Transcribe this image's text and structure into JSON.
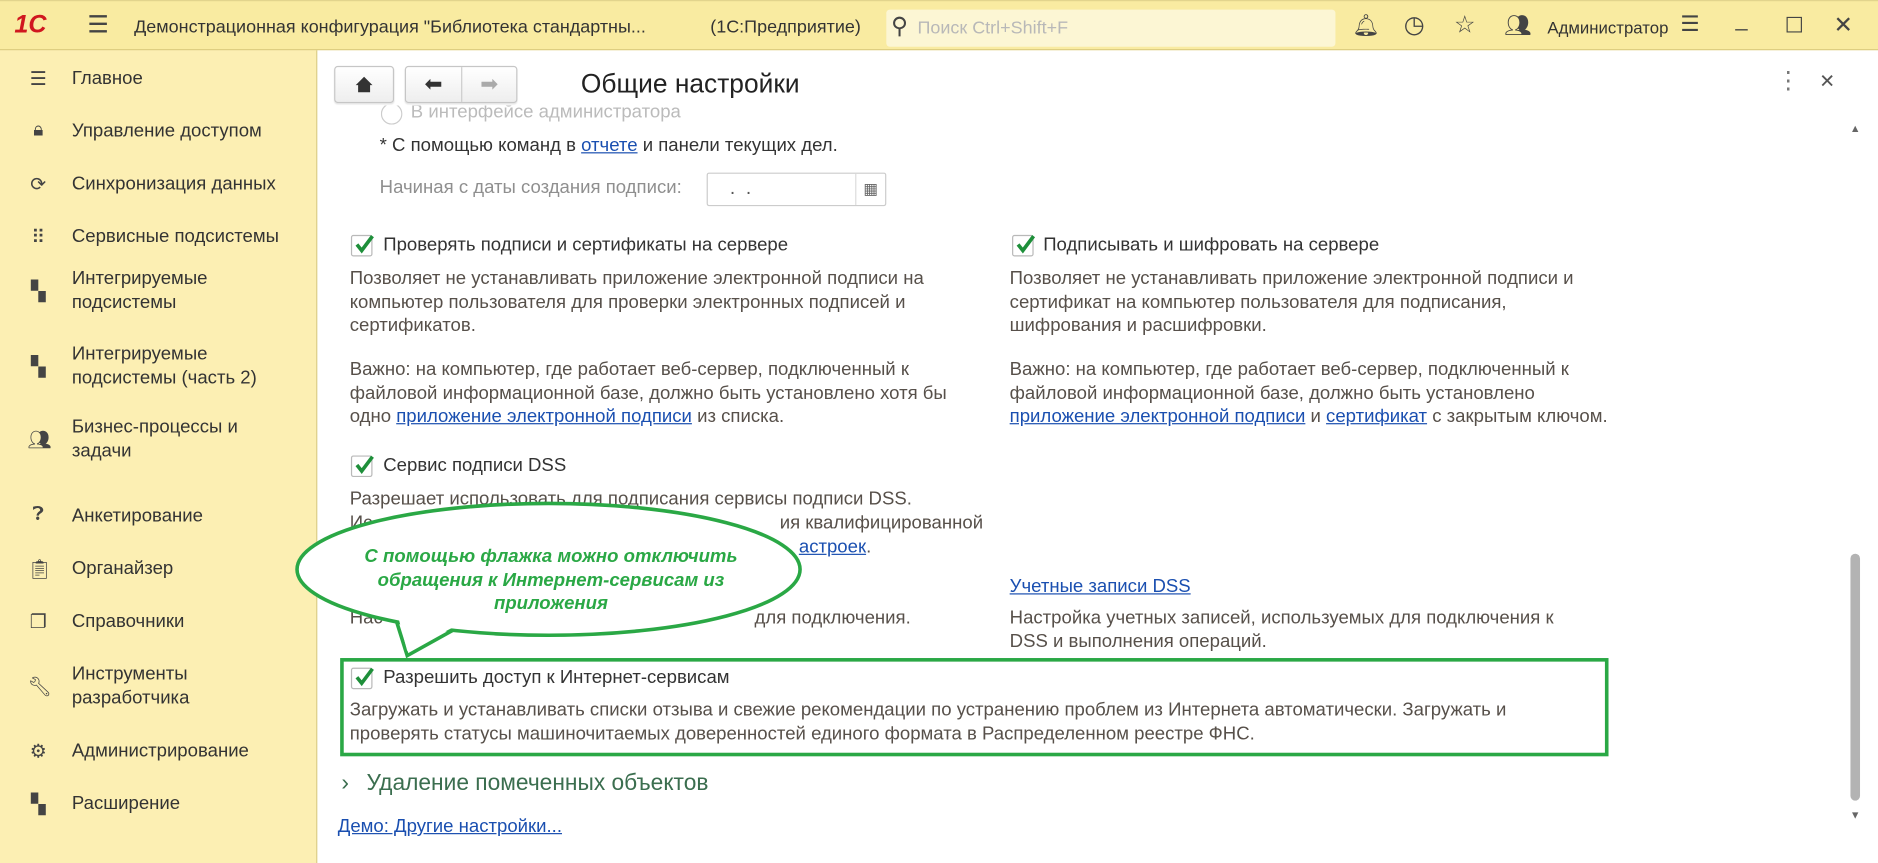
{
  "titlebar": {
    "logo": "1С",
    "app_title": "Демонстрационная конфигурация \"Библиотека стандартны...",
    "platform": "(1С:Предприятие)",
    "search_placeholder": "Поиск Ctrl+Shift+F",
    "user": "Администратор"
  },
  "sidebar": {
    "items": [
      {
        "label": "Главное",
        "icon": "menu-icon"
      },
      {
        "label": "Управление доступом",
        "icon": "lock-icon"
      },
      {
        "label": "Синхронизация данных",
        "icon": "sync-icon"
      },
      {
        "label": "Сервисные подсистемы",
        "icon": "grid-icon"
      },
      {
        "label": "Интегрируемые подсистемы",
        "icon": "blocks-icon"
      },
      {
        "label": "Интегрируемые подсистемы (часть 2)",
        "icon": "blocks-icon"
      },
      {
        "label": "Бизнес-процессы и задачи",
        "icon": "users-icon"
      },
      {
        "label": "Анкетирование",
        "icon": "question-icon"
      },
      {
        "label": "Органайзер",
        "icon": "clipboard-icon"
      },
      {
        "label": "Справочники",
        "icon": "books-icon"
      },
      {
        "label": "Инструменты разработчика",
        "icon": "wrench-icon"
      },
      {
        "label": "Администрирование",
        "icon": "gear-icon"
      },
      {
        "label": "Расширение",
        "icon": "blocks-icon"
      }
    ]
  },
  "form": {
    "title": "Общие настройки",
    "radio_admin": "В интерфейсе администратора",
    "note_prefix": "* С помощью команд в ",
    "note_link": "отчете",
    "note_suffix": " и панели текущих дел.",
    "date_label": "Начиная с даты создания подписи:",
    "date_value": " .  . ",
    "check_server": {
      "label": "Проверять подписи и сертификаты на сервере",
      "checked": true,
      "desc": [
        "Позволяет не устанавливать приложение электронной подписи на",
        "компьютер пользователя для проверки электронных подписей и",
        "сертификатов."
      ],
      "important": [
        "Важно: на компьютер, где работает веб-сервер, подключенный к",
        "файловой информационной базе, должно быть установлено хотя бы"
      ],
      "important_last_prefix": "одно ",
      "important_link": "приложение электронной подписи",
      "important_last_suffix": " из списка."
    },
    "sign_server": {
      "label": "Подписывать и шифровать на сервере",
      "checked": true,
      "desc": [
        "Позволяет не устанавливать приложение электронной подписи и",
        "сертификат на компьютер пользователя для подписания,",
        "шифрования и расшифровки."
      ],
      "important": [
        "Важно: на компьютер, где работает веб-сервер, подключенный к",
        "файловой информационной базе, должно быть установлено"
      ],
      "link1": "приложение электронной подписи",
      "and": " и ",
      "link2": "сертификат",
      "suffix": " с закрытым ключом."
    },
    "dss": {
      "label": "Сервис подписи DSS",
      "checked": true,
      "desc1": "Разрешает использовать для подписания сервисы подписи DSS.",
      "desc2_a": "Ис",
      "desc2_b": "ия квалифицированной",
      "desc3_link": "астроек",
      "desc3_end": ".",
      "desc4_a": "Нас",
      "desc4_b": "для подключения."
    },
    "dss_accounts": {
      "link": "Учетные записи DSS",
      "desc": [
        "Настройка учетных записей, используемых для подключения к",
        "DSS и выполнения операций."
      ]
    },
    "internet": {
      "label": "Разрешить доступ к Интернет-сервисам",
      "checked": true,
      "desc": [
        "Загружать и устанавливать списки отзыва и свежие рекомендации по устранению проблем из Интернета автоматически. Загружать и",
        "проверять статусы машиночитаемых доверенностей единого формата в Распределенном реестре ФНС."
      ]
    },
    "group_deletion": "Удаление помеченных объектов",
    "demo_link": "Демо: Другие настройки..."
  },
  "callout": {
    "lines": [
      "С помощью флажка можно отключить",
      "обращения к Интернет-сервисам из",
      "приложения"
    ],
    "color": "#2aa845"
  },
  "colors": {
    "titlebar": "#f9eba1",
    "sidebar": "#fcefb3",
    "highlight": "#2aa845",
    "logo": "#d0171f"
  }
}
